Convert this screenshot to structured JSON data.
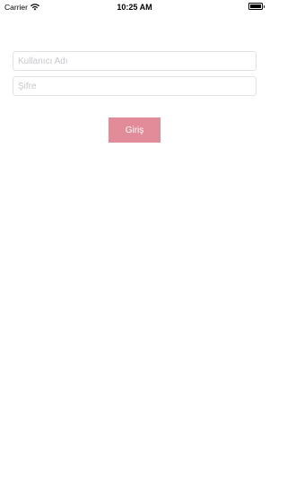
{
  "status_bar": {
    "carrier": "Carrier",
    "time": "10:25 AM",
    "wifi_icon": "wifi-icon",
    "battery_icon": "battery-icon",
    "battery_level": 1.0
  },
  "form": {
    "username": {
      "placeholder": "Kullanıcı Adı",
      "value": ""
    },
    "password": {
      "placeholder": "Şifre",
      "value": ""
    },
    "login_label": "Giriş"
  },
  "colors": {
    "login_button_bg": "#e28c9a",
    "login_button_text": "#ffffff",
    "field_border": "#e3e3e3",
    "placeholder": "#c7c7cd",
    "background": "#ffffff"
  }
}
